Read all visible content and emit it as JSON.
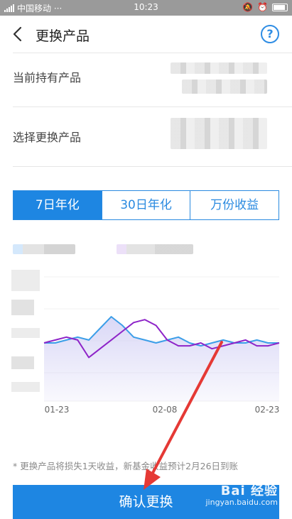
{
  "status_bar": {
    "carrier": "中国移动 ···",
    "time": "10:23"
  },
  "nav": {
    "title": "更换产品",
    "help_glyph": "?"
  },
  "rows": {
    "current_label": "当前持有产品",
    "select_label": "选择更换产品"
  },
  "tabs": [
    {
      "label": "7日年化",
      "active": true
    },
    {
      "label": "30日年化",
      "active": false
    },
    {
      "label": "万份收益",
      "active": false
    }
  ],
  "chart_data": {
    "type": "line",
    "x_ticks": [
      "01-23",
      "02-08",
      "02-23"
    ],
    "series": [
      {
        "color": "#3b9ee8",
        "values": [
          4.0,
          4.0,
          4.05,
          4.1,
          4.05,
          4.25,
          4.45,
          4.3,
          4.1,
          4.05,
          4.0,
          4.05,
          4.1,
          4.0,
          3.95,
          4.0,
          4.05,
          4.0,
          4.0,
          4.05,
          4.0,
          4.0
        ]
      },
      {
        "color": "#8e24c8",
        "values": [
          4.0,
          4.05,
          4.1,
          4.05,
          3.75,
          3.9,
          4.05,
          4.2,
          4.35,
          4.4,
          4.3,
          4.05,
          3.95,
          3.95,
          4.0,
          3.9,
          3.95,
          4.0,
          4.05,
          3.95,
          3.95,
          4.0
        ]
      }
    ],
    "ylim": [
      3.0,
      5.5
    ],
    "area_fill": "#d8d6f6"
  },
  "note": "* 更换产品将损失1天收益，新基金收益预计2月26日到账",
  "confirm_label": "确认更换",
  "watermark": {
    "brand": "Bai 经验",
    "url": "jingyan.baidu.com"
  },
  "colors": {
    "accent": "#1e86e2",
    "arrow": "#e53935"
  }
}
